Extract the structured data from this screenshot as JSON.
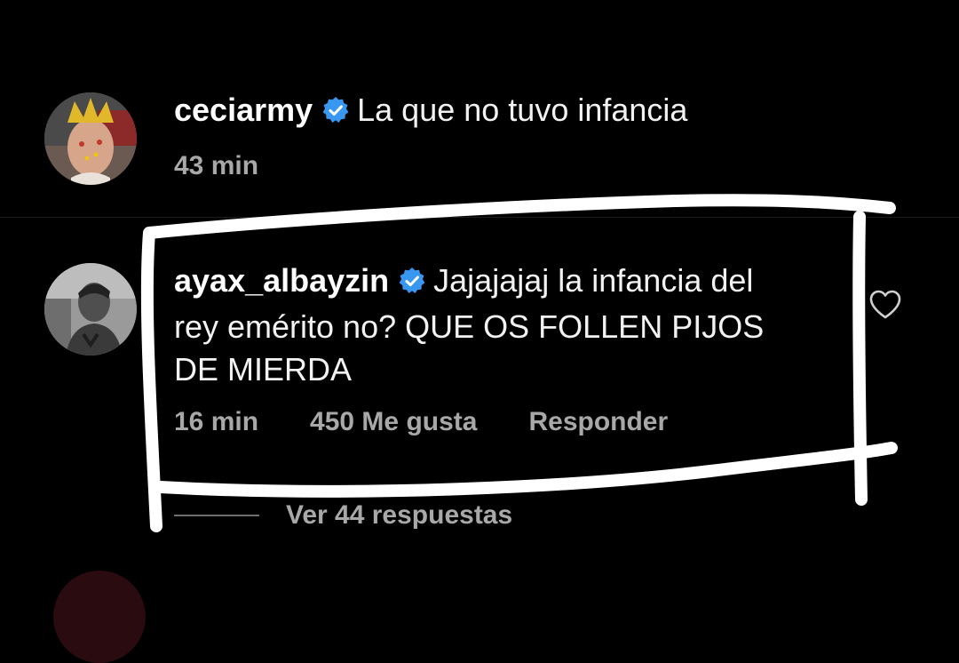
{
  "comments": [
    {
      "username": "ceciarmy",
      "verified": true,
      "text": "La que no tuvo infancia",
      "time": "43 min"
    },
    {
      "username": "ayax_albayzin",
      "verified": true,
      "text": "Jajajajaj la infancia del rey emérito no? QUE OS FOLLEN PIJOS DE MIERDA",
      "time": "16 min",
      "likes": "450 Me gusta",
      "reply_label": "Responder",
      "view_replies": "Ver 44 respuestas"
    }
  ],
  "icons": {
    "verified": "verified-badge-icon",
    "like": "heart-outline-icon"
  },
  "colors": {
    "background": "#000000",
    "text": "#f2f2f2",
    "meta": "#a8a8a8",
    "verified": "#3897f0",
    "annotation": "#ffffff"
  }
}
